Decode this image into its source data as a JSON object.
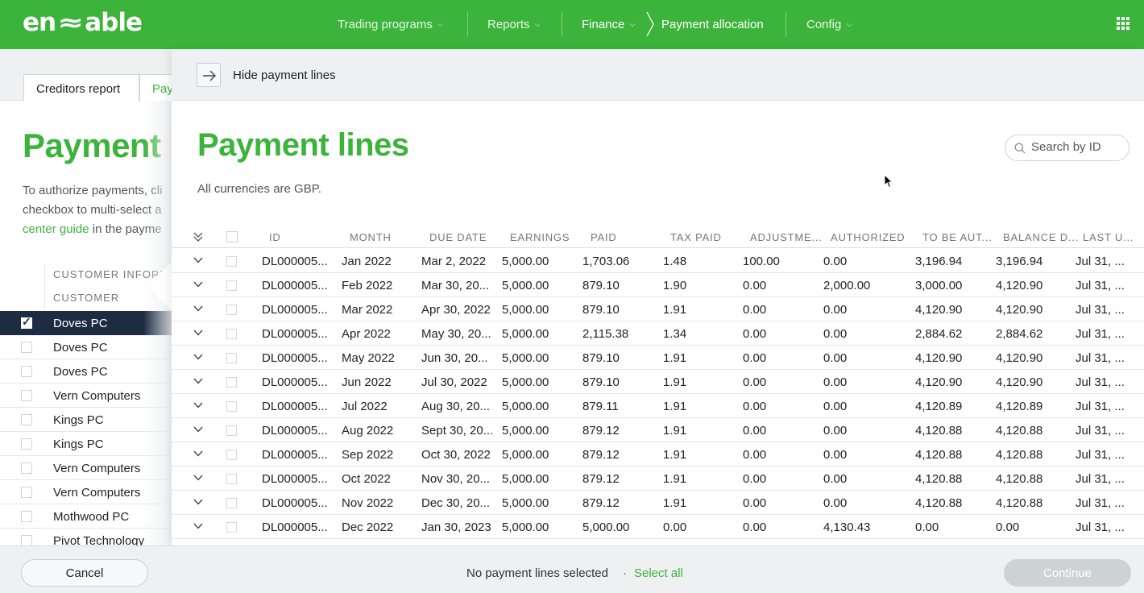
{
  "app": {
    "logo": "enable"
  },
  "nav": {
    "items": [
      "Trading programs",
      "Reports",
      "Finance"
    ],
    "current": "Payment allocation",
    "config": "Config"
  },
  "background": {
    "tabs": [
      "Creditors report",
      "Pay"
    ],
    "title": "Payment",
    "text_lines": [
      "To authorize payments, cli",
      "checkbox to multi-select a"
    ],
    "guide_link": "center guide",
    "guide_rest": " in the payme",
    "col_header_1": "CUSTOMER INFORMAT",
    "col_header_2": "CUSTOMER",
    "customers": [
      {
        "name": "Doves PC",
        "checked": true
      },
      {
        "name": "Doves PC",
        "checked": false
      },
      {
        "name": "Doves PC",
        "checked": false
      },
      {
        "name": "Vern Computers",
        "checked": false
      },
      {
        "name": "Kings PC",
        "checked": false
      },
      {
        "name": "Kings PC",
        "checked": false
      },
      {
        "name": "Vern Computers",
        "checked": false
      },
      {
        "name": "Vern Computers",
        "checked": false
      },
      {
        "name": "Mothwood PC",
        "checked": false
      },
      {
        "name": "Pivot Technology",
        "checked": false
      }
    ]
  },
  "panel": {
    "hide_label": "Hide payment lines",
    "title": "Payment lines",
    "note": "All currencies are GBP.",
    "search_placeholder": "Search by ID"
  },
  "table": {
    "columns": [
      "ID",
      "MONTH",
      "DUE DATE",
      "EARNINGS",
      "PAID",
      "TAX PAID",
      "ADJUSTME...",
      "AUTHORIZED",
      "TO BE AUT...",
      "BALANCE D...",
      "LAST U..."
    ],
    "rows": [
      [
        "DL000005...",
        "Jan 2022",
        "Mar 2, 2022",
        "5,000.00",
        "1,703.06",
        "1.48",
        "100.00",
        "0.00",
        "3,196.94",
        "3,196.94",
        "Jul 31, ..."
      ],
      [
        "DL000005...",
        "Feb 2022",
        "Mar 30, 20...",
        "5,000.00",
        "879.10",
        "1.90",
        "0.00",
        "2,000.00",
        "3,000.00",
        "4,120.90",
        "Jul 31, ..."
      ],
      [
        "DL000005...",
        "Mar 2022",
        "Apr 30, 2022",
        "5,000.00",
        "879.10",
        "1.91",
        "0.00",
        "0.00",
        "4,120.90",
        "4,120.90",
        "Jul 31, ..."
      ],
      [
        "DL000005...",
        "Apr 2022",
        "May 30, 20...",
        "5,000.00",
        "2,115.38",
        "1.34",
        "0.00",
        "0.00",
        "2,884.62",
        "2,884.62",
        "Jul 31, ..."
      ],
      [
        "DL000005...",
        "May 2022",
        "Jun 30, 20...",
        "5,000.00",
        "879.10",
        "1.91",
        "0.00",
        "0.00",
        "4,120.90",
        "4,120.90",
        "Jul 31, ..."
      ],
      [
        "DL000005...",
        "Jun 2022",
        "Jul 30, 2022",
        "5,000.00",
        "879.10",
        "1.91",
        "0.00",
        "0.00",
        "4,120.90",
        "4,120.90",
        "Jul 31, ..."
      ],
      [
        "DL000005...",
        "Jul 2022",
        "Aug 30, 20...",
        "5,000.00",
        "879.11",
        "1.91",
        "0.00",
        "0.00",
        "4,120.89",
        "4,120.89",
        "Jul 31, ..."
      ],
      [
        "DL000005...",
        "Aug 2022",
        "Sept 30, 20...",
        "5,000.00",
        "879.12",
        "1.91",
        "0.00",
        "0.00",
        "4,120.88",
        "4,120.88",
        "Jul 31, ..."
      ],
      [
        "DL000005...",
        "Sep 2022",
        "Oct 30, 2022",
        "5,000.00",
        "879.12",
        "1.91",
        "0.00",
        "0.00",
        "4,120.88",
        "4,120.88",
        "Jul 31, ..."
      ],
      [
        "DL000005...",
        "Oct 2022",
        "Nov 30, 20...",
        "5,000.00",
        "879.12",
        "1.91",
        "0.00",
        "0.00",
        "4,120.88",
        "4,120.88",
        "Jul 31, ..."
      ],
      [
        "DL000005...",
        "Nov 2022",
        "Dec 30, 20...",
        "5,000.00",
        "879.12",
        "1.91",
        "0.00",
        "0.00",
        "4,120.88",
        "4,120.88",
        "Jul 31, ..."
      ],
      [
        "DL000005...",
        "Dec 2022",
        "Jan 30, 2023",
        "5,000.00",
        "5,000.00",
        "0.00",
        "0.00",
        "4,130.43",
        "0.00",
        "0.00",
        "Jul 31, ..."
      ]
    ]
  },
  "footer": {
    "cancel": "Cancel",
    "status": "No payment lines selected",
    "dot": "·",
    "select_all": "Select all",
    "continue": "Continue"
  },
  "colors": {
    "brand_green": "#3cb43c",
    "selected_row": "#1e2c43"
  }
}
